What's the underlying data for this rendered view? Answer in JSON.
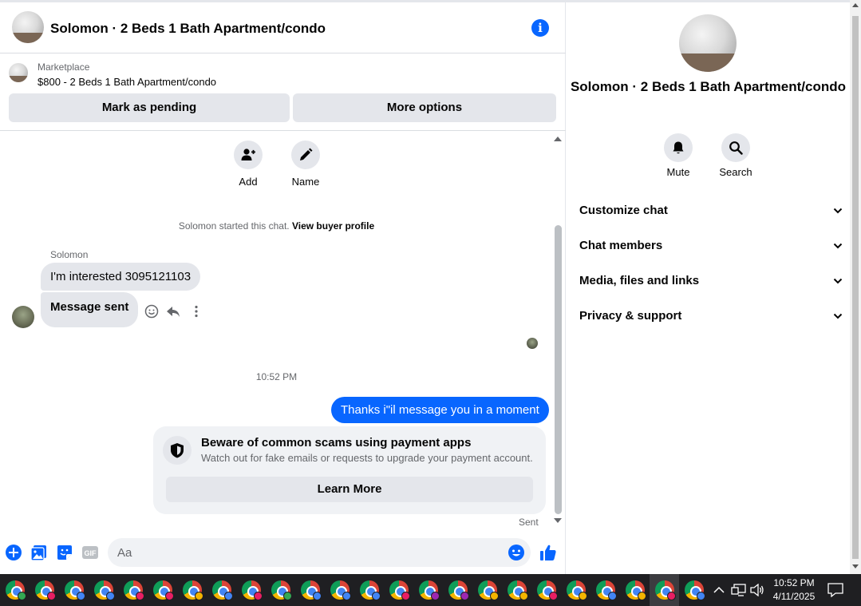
{
  "header": {
    "title": "Solomon · 2 Beds 1 Bath Apartment/condo"
  },
  "marketplace": {
    "label": "Marketplace",
    "item": "$800 - 2 Beds 1 Bath Apartment/condo",
    "mark_pending": "Mark as pending",
    "more_options": "More options"
  },
  "quick_actions": {
    "add": "Add",
    "name": "Name"
  },
  "system_message": {
    "text": "Solomon started this chat.",
    "link": "View buyer profile"
  },
  "messages": {
    "sender": "Solomon",
    "incoming_1": "I'm interested 3095121103",
    "incoming_2": "Message sent",
    "timestamp": "10:52 PM",
    "outgoing_1": "Thanks i\"il message you in a moment",
    "status": "Sent"
  },
  "scam_warning": {
    "title": "Beware of common scams using payment apps",
    "subtitle": "Watch out for fake emails or requests to upgrade your payment account.",
    "button": "Learn More"
  },
  "composer": {
    "placeholder": "Aa"
  },
  "info_panel": {
    "title": "Solomon · 2 Beds 1 Bath Apartment/condo",
    "mute": "Mute",
    "search": "Search",
    "sections": [
      "Customize chat",
      "Chat members",
      "Media, files and links",
      "Privacy & support"
    ]
  },
  "taskbar": {
    "time": "10:52 PM",
    "date": "4/11/2025",
    "profile_colors": [
      "#34a853",
      "#e91e63",
      "#4285f4",
      "#4285f4",
      "#e91e63",
      "#e91e63",
      "#f4b400",
      "#4285f4",
      "#e91e63",
      "#34a853",
      "#4285f4",
      "#4285f4",
      "#4285f4",
      "#e91e63",
      "#9c27b0",
      "#9c27b0",
      "#f4b400",
      "#f4b400",
      "#e91e63",
      "#f4b400",
      "#4285f4",
      "#f4b400",
      "#e91e63",
      "#4285f4"
    ]
  },
  "colors": {
    "accent": "#0866ff",
    "bubble_in": "#e4e6eb",
    "muted_text": "#65676b"
  }
}
